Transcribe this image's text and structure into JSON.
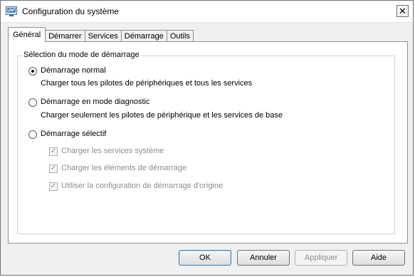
{
  "window": {
    "title": "Configuration du système"
  },
  "tabs": [
    {
      "label": "Général"
    },
    {
      "label": "Démarrer"
    },
    {
      "label": "Services"
    },
    {
      "label": "Démarrage"
    },
    {
      "label": "Outils"
    }
  ],
  "group": {
    "legend": "Sélection du mode de démarrage"
  },
  "options": [
    {
      "label": "Démarrage normal",
      "description": "Charger tous les pilotes de périphériques et tous les services",
      "selected": true
    },
    {
      "label": "Démarrage en mode diagnostic",
      "description": "Charger seulement les pilotes de périphérique et les services de base",
      "selected": false
    },
    {
      "label": "Démarrage sélectif",
      "selected": false
    }
  ],
  "selective": [
    {
      "label": "Charger les services système",
      "checked": true,
      "enabled": false
    },
    {
      "label": "Charger les éléments de démarrage",
      "checked": true,
      "enabled": false
    },
    {
      "label": "Utiliser la configuration de démarrage d'origine",
      "checked": true,
      "enabled": false
    }
  ],
  "buttons": {
    "ok": "OK",
    "cancel": "Annuler",
    "apply": "Appliquer",
    "help": "Aide"
  },
  "icons": {
    "app": "msconfig-icon",
    "close": "close-icon"
  }
}
